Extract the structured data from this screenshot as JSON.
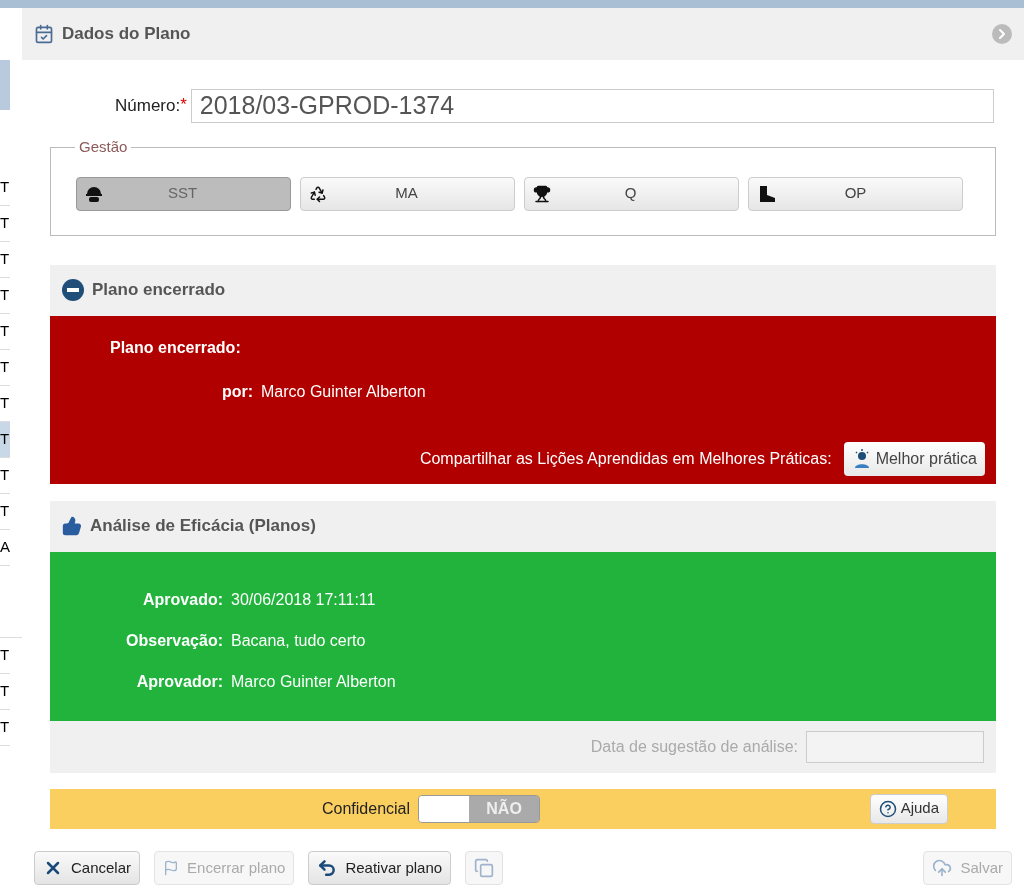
{
  "background_list": {
    "cells": [
      {
        "text": "T",
        "selected": false
      },
      {
        "text": "T",
        "selected": false
      },
      {
        "text": "T",
        "selected": false
      },
      {
        "text": "T",
        "selected": false
      },
      {
        "text": "T",
        "selected": false
      },
      {
        "text": "T",
        "selected": false
      },
      {
        "text": "T",
        "selected": false
      },
      {
        "text": "T",
        "selected": true
      },
      {
        "text": "T",
        "selected": false
      },
      {
        "text": "T",
        "selected": false
      },
      {
        "text": "A",
        "selected": false
      },
      {
        "text": "T",
        "selected": false
      },
      {
        "text": "T",
        "selected": false
      },
      {
        "text": "T",
        "selected": false
      }
    ]
  },
  "window": {
    "title": "Dados do Plano"
  },
  "numero": {
    "label": "Número:",
    "required_mark": "*",
    "value": "2018/03-GPROD-1374"
  },
  "gestao": {
    "legend": "Gestão",
    "options": [
      {
        "label": "SST",
        "kind": "helmet",
        "selected": true
      },
      {
        "label": "MA",
        "kind": "recycle",
        "selected": false
      },
      {
        "label": "Q",
        "kind": "trophy",
        "selected": false
      },
      {
        "label": "OP",
        "kind": "boot",
        "selected": false
      }
    ]
  },
  "closed_section": {
    "title": "Plano encerrado",
    "heading": "Plano encerrado:",
    "fields": [
      {
        "label": "por:",
        "value": "Marco Guinter Alberton"
      }
    ],
    "share_label": "Compartilhar as Lições Aprendidas em Melhores Práticas:",
    "share_button": "Melhor prática"
  },
  "efficacy_section": {
    "title": "Análise de Eficácia (Planos)",
    "fields": [
      {
        "label": "Aprovado:",
        "value": "30/06/2018 17:11:11"
      },
      {
        "label": "Observação:",
        "value": "Bacana, tudo certo"
      },
      {
        "label": "Aprovador:",
        "value": "Marco Guinter Alberton"
      }
    ],
    "suggestion_label": "Data de sugestão de análise:"
  },
  "confidential": {
    "label": "Confidencial",
    "on": false,
    "off_label": "NÃO",
    "help_button": "Ajuda"
  },
  "footer": {
    "buttons": [
      {
        "kind": "cancel",
        "label": "Cancelar",
        "disabled": false
      },
      {
        "kind": "close",
        "label": "Encerrar plano",
        "disabled": true
      },
      {
        "kind": "reactivate",
        "label": "Reativar plano",
        "disabled": false
      },
      {
        "kind": "copy",
        "disabled": true
      },
      {
        "kind": "save",
        "label": "Salvar",
        "disabled": true
      }
    ]
  }
}
